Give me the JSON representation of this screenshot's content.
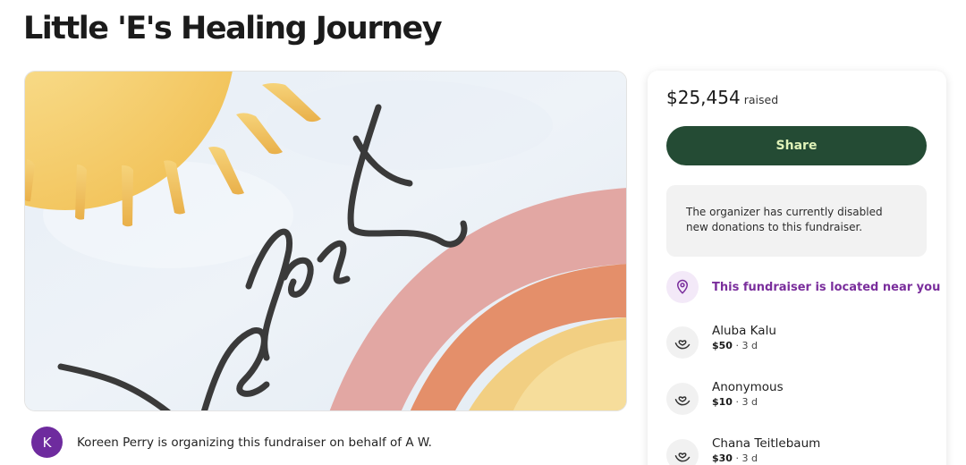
{
  "page": {
    "title": "Little 'E's Healing Journey"
  },
  "hero": {
    "script_text": "Love for E"
  },
  "organizer": {
    "avatar_letter": "K",
    "text": "Koreen Perry is organizing this fundraiser on behalf of A W."
  },
  "sidebar": {
    "amount": "$25,454",
    "amount_label": "raised",
    "share_label": "Share",
    "notice": "The organizer has currently disabled new donations to this fundraiser.",
    "location_text": "This fundraiser is located near you",
    "donations": [
      {
        "name": "Aluba Kalu",
        "amount": "$50",
        "time": "· 3 d"
      },
      {
        "name": "Anonymous",
        "amount": "$10",
        "time": "· 3 d"
      },
      {
        "name": "Chana Teitlebaum",
        "amount": "$30",
        "time": "· 3 d"
      }
    ]
  },
  "colors": {
    "share_bg": "#244b34",
    "share_text": "#dff2b8",
    "location_accent": "#7a2e9c",
    "avatar_bg": "#6e2b9e"
  },
  "icons": {
    "location": "location-pin-icon",
    "donation": "heart-hand-icon"
  }
}
